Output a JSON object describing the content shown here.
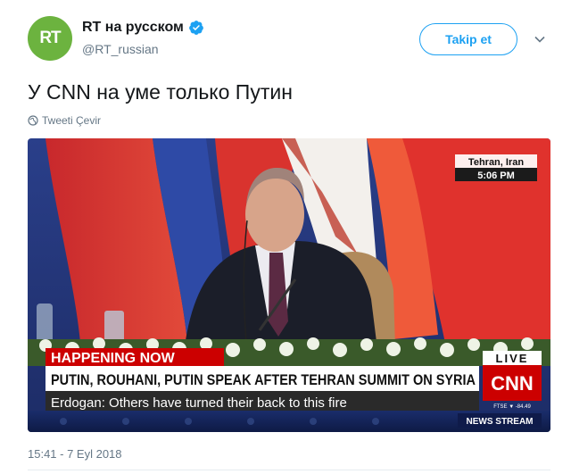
{
  "account": {
    "avatar_text": "RT",
    "display_name": "RT на русском",
    "handle": "@RT_russian",
    "verified_icon": "verified-badge-icon"
  },
  "follow_button": {
    "label": "Takip et"
  },
  "tweet": {
    "text": "У CNN на уме только Путин",
    "translate_label": "Tweeti Çevir",
    "timestamp": "15:41 - 7 Eyl 2018"
  },
  "media": {
    "location": "Tehran, Iran",
    "time": "5:06 PM",
    "happening_now": "HAPPENING NOW",
    "headline": "PUTIN, ROUHANI, PUTIN SPEAK AFTER TEHRAN SUMMIT ON SYRIA",
    "subheadline": "Erdogan: Others have turned their back to this fire",
    "live_label": "LIVE",
    "network": "CNN",
    "ticker": "FTSE ▼ -84.49",
    "show_name": "NEWS STREAM"
  },
  "colors": {
    "brand_blue": "#1da1f2",
    "rt_green": "#6cb33f",
    "cnn_red": "#cc0000"
  }
}
